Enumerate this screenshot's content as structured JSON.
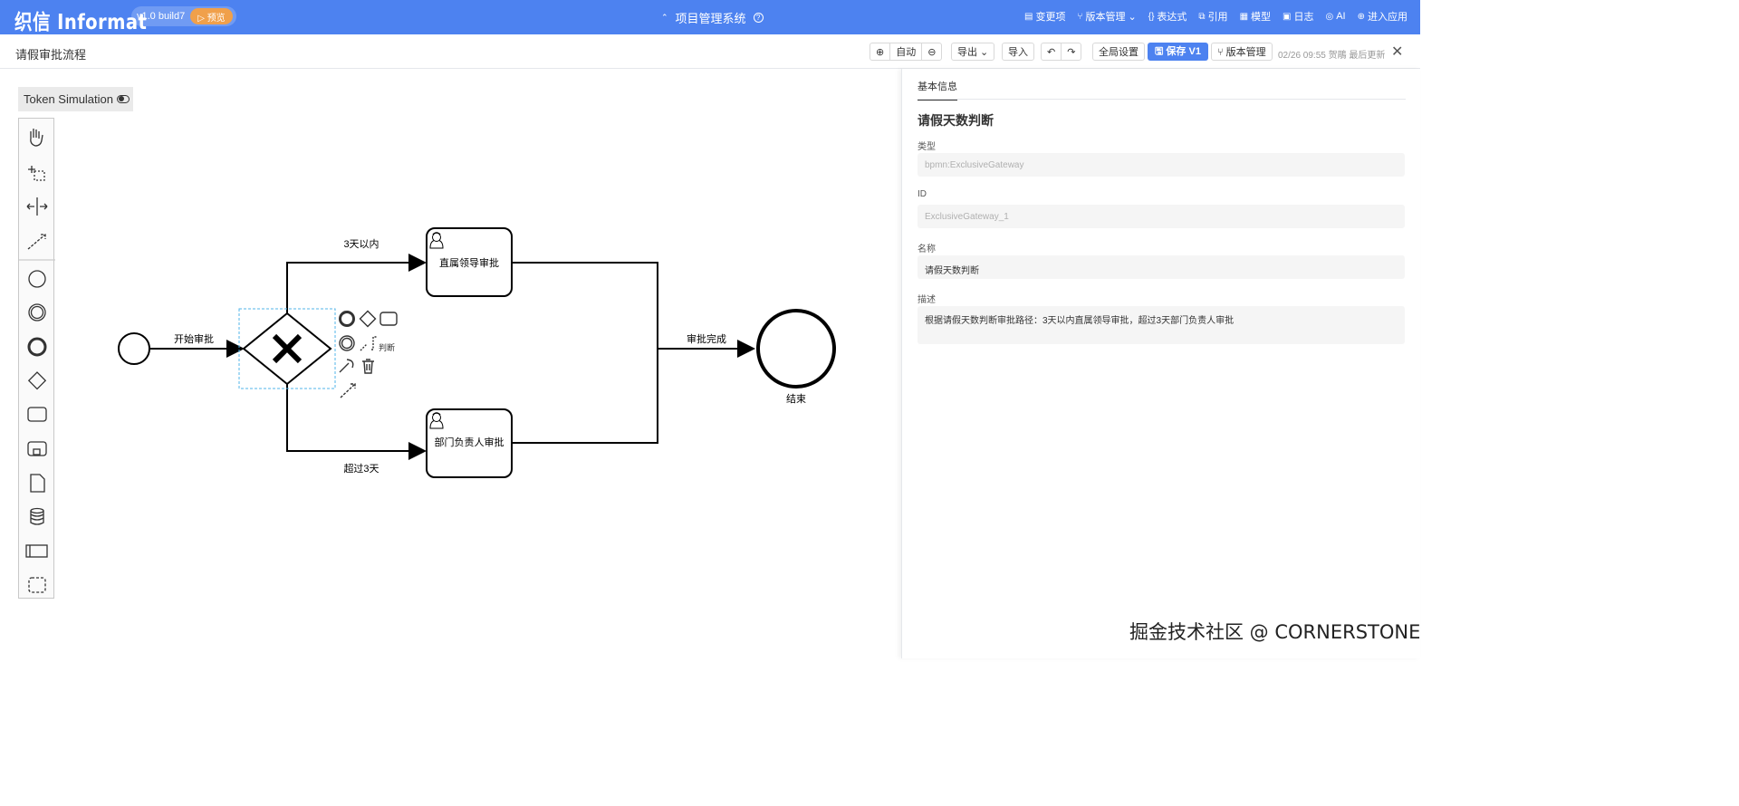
{
  "header": {
    "brand": "织信 Informat",
    "version": "v1.0 build7",
    "preview_label": "▷ 预览",
    "app_title": "项目管理系统",
    "help": "?",
    "nav": [
      {
        "icon": "▤",
        "label": "变更项"
      },
      {
        "icon": "⑂",
        "label": "版本管理 ⌄"
      },
      {
        "icon": "{}",
        "label": "表达式"
      },
      {
        "icon": "⧉",
        "label": "引用"
      },
      {
        "icon": "▦",
        "label": "模型"
      },
      {
        "icon": "▣",
        "label": "日志"
      },
      {
        "icon": "◎",
        "label": "AI"
      },
      {
        "icon": "⊕",
        "label": "进入应用"
      }
    ]
  },
  "toolbar": {
    "flow_title": "请假审批流程",
    "zoom_in": "⊕",
    "zoom_auto": "自动",
    "zoom_out": "⊖",
    "export": "导出 ⌄",
    "import": "导入",
    "undo": "↶",
    "redo": "↷",
    "global_settings": "全局设置",
    "save": "🖫 保存 V1",
    "version_mgmt": "⑂ 版本管理",
    "meta": "02/26 09:55 贺鵰 最后更新",
    "close": "✕"
  },
  "canvas": {
    "token_simulation": "Token Simulation",
    "palette_tools": [
      "hand-tool",
      "lasso-tool",
      "space-tool",
      "connect-tool",
      "start-event",
      "intermediate-event",
      "end-event",
      "gateway",
      "task",
      "subprocess",
      "data-object",
      "data-store",
      "pool",
      "group"
    ],
    "diagram": {
      "start_label": "开始审批",
      "task1_label": "直属领导审批",
      "task2_label": "部门负责人审批",
      "flow_top_label": "3天以内",
      "flow_bottom_label": "超过3天",
      "flow_end_label": "审批完成",
      "end_label": "结束",
      "context_text": "判断"
    }
  },
  "panel": {
    "tab": "基本信息",
    "heading": "请假天数判断",
    "fields": [
      {
        "label": "类型",
        "value": "bpmn:ExclusiveGateway"
      },
      {
        "label": "ID",
        "value": "ExclusiveGateway_1"
      },
      {
        "label": "名称",
        "value": "请假天数判断"
      },
      {
        "label": "描述",
        "value": "根据请假天数判断审批路径：3天以内直属领导审批，超过3天部门负责人审批"
      }
    ]
  },
  "watermark": "掘金技术社区 @ CORNERSTONE"
}
